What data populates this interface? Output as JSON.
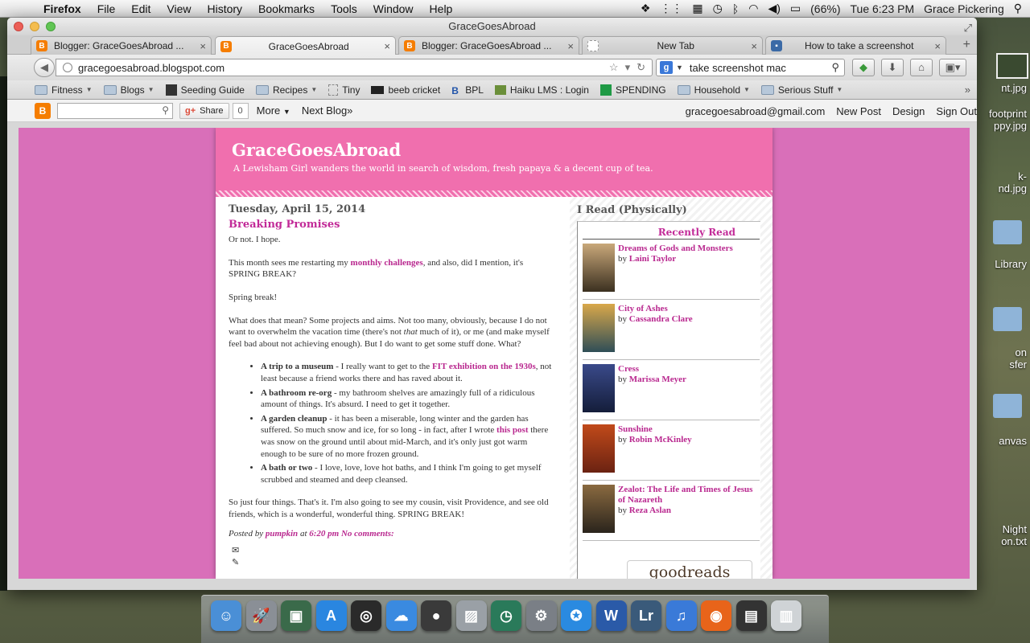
{
  "menubar": {
    "app_name": "Firefox",
    "menus": [
      "File",
      "Edit",
      "View",
      "History",
      "Bookmarks",
      "Tools",
      "Window",
      "Help"
    ],
    "battery": "(66%)",
    "clock": "Tue 6:23 PM",
    "user": "Grace Pickering"
  },
  "window": {
    "title": "GraceGoesAbroad"
  },
  "tabs": [
    {
      "label": "Blogger: GraceGoesAbroad ..."
    },
    {
      "label": "GraceGoesAbroad"
    },
    {
      "label": "Blogger: GraceGoesAbroad ..."
    },
    {
      "label": "New Tab"
    },
    {
      "label": "How to take a screenshot"
    }
  ],
  "navbar": {
    "url": "gracegoesabroad.blogspot.com",
    "search_query": "take screenshot mac"
  },
  "bookmarks": [
    {
      "label": "Fitness",
      "icon": "folder",
      "menu": true
    },
    {
      "label": "Blogs",
      "icon": "folder",
      "menu": true
    },
    {
      "label": "Seeding Guide",
      "icon": "grid"
    },
    {
      "label": "Recipes",
      "icon": "folder",
      "menu": true
    },
    {
      "label": "Tiny",
      "icon": "blank"
    },
    {
      "label": "beeb cricket",
      "icon": "bbc"
    },
    {
      "label": "BPL",
      "icon": "bpl"
    },
    {
      "label": "Haiku LMS : Login",
      "icon": "haiku"
    },
    {
      "label": "SPENDING",
      "icon": "sheet"
    },
    {
      "label": "Household",
      "icon": "folder",
      "menu": true
    },
    {
      "label": "Serious Stuff",
      "icon": "folder",
      "menu": true
    }
  ],
  "bloggerbar": {
    "share": "Share",
    "share_count": "0",
    "more": "More",
    "next_blog": "Next Blog»",
    "email": "gracegoesabroad@gmail.com",
    "new_post": "New Post",
    "design": "Design",
    "sign_out": "Sign Out"
  },
  "blog": {
    "title": "GraceGoesAbroad",
    "description": "A Lewisham Girl wanders the world in search of wisdom, fresh papaya & a decent cup of tea.",
    "post": {
      "date": "Tuesday, April 15, 2014",
      "title": "Breaking Promises",
      "p1": "Or not.  I hope.",
      "p2_a": "This month sees me restarting my ",
      "p2_link": "monthly challenges",
      "p2_b": ", and also, did I mention, it's SPRING BREAK?",
      "p3": "Spring break!",
      "p4_a": "What does that mean?  Some projects and aims.  Not too many, obviously, because I do not want to overwhelm the vacation time (there's not ",
      "p4_em": "that",
      "p4_b": " much of it), or me (and make myself feel bad about not achieving enough).  But I do want to get some stuff done.  What?",
      "list": [
        {
          "bold": "A trip to a museum",
          "a": " - I really want to get to the ",
          "link": "FIT exhibition on the 1930s",
          "b": ", not least because a friend works there and has raved about it."
        },
        {
          "bold": "A bathroom re-org",
          "a": " - my bathroom shelves are amazingly full of a ridiculous amount of things.  It's absurd.  I need to get it together.",
          "link": "",
          "b": ""
        },
        {
          "bold": "A garden cleanup",
          "a": " - it has been a miserable, long winter and the garden has suffered.  So much snow and ice, for so long - in fact, after I wrote ",
          "link": "this post",
          "b": " there was snow on the ground until about mid-March, and it's only just got warm enough to be sure of no more frozen ground."
        },
        {
          "bold": "A bath or two",
          "a": " - I love, love, love hot baths, and I think I'm going to get myself scrubbed and steamed and deep cleansed.",
          "link": "",
          "b": ""
        }
      ],
      "p5": "So just four things.  That's it.  I'm also going to see my cousin, visit Providence, and see old friends, which is a wonderful, wonderful thing.  SPRING BREAK!",
      "footer_posted_by": "Posted by ",
      "footer_author": "pumpkin",
      "footer_at": " at ",
      "footer_time": "6:20 pm",
      "footer_comments": "No comments:"
    },
    "sidebar": {
      "title": "I Read (Physically)",
      "heading": "Recently Read",
      "by": "by ",
      "books": [
        {
          "title": "Dreams of Gods and Monsters",
          "author": "Laini Taylor",
          "color": "#3b3020"
        },
        {
          "title": "City of Ashes",
          "author": "Cassandra Clare",
          "color": "#2f4e57"
        },
        {
          "title": "Cress",
          "author": "Marissa Meyer",
          "color": "#141d3a"
        },
        {
          "title": "Sunshine",
          "author": "Robin McKinley",
          "color": "#6b2212"
        },
        {
          "title": "Zealot: The Life and Times of Jesus of Nazareth",
          "author": "Reza Aslan",
          "color": "#2a241c"
        }
      ],
      "widget": "goodreads"
    }
  },
  "desktop": {
    "items": [
      "nt.jpg",
      "footprint",
      "ppy.jpg",
      "k-",
      "nd.jpg",
      "Library",
      "on",
      "sfer",
      "anvas",
      "Night",
      "on.txt"
    ]
  },
  "dock": {
    "icons": [
      "finder-icon",
      "launchpad-icon",
      "iphoto-icon",
      "app-store-icon",
      "dashboard-icon",
      "messages-icon",
      "facetime-icon",
      "preview-icon",
      "time-machine-icon",
      "system-preferences-icon",
      "safari-icon",
      "word-icon",
      "lightroom-icon",
      "itunes-icon",
      "firefox-icon",
      "printer-icon",
      "trash-icon"
    ]
  }
}
